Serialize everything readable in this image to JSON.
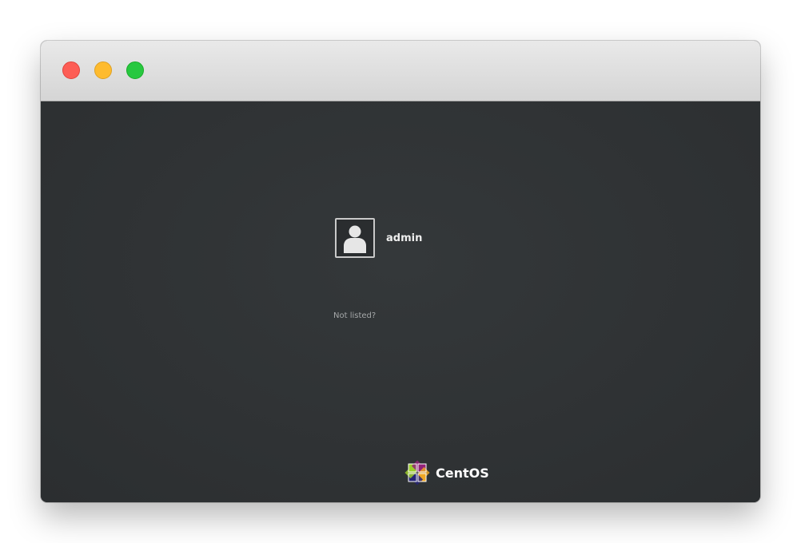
{
  "window": {
    "controls": {
      "close_color": "#fd5d55",
      "minimize_color": "#febb2e",
      "maximize_color": "#27c83f"
    }
  },
  "login": {
    "users": [
      {
        "name": "admin",
        "avatar_icon": "user-avatar-icon"
      }
    ],
    "not_listed_label": "Not listed?"
  },
  "branding": {
    "logo_icon": "centos-logo-icon",
    "name": "CentOS"
  },
  "colors": {
    "background": "#2f3234",
    "text_primary": "#eeeeee",
    "text_secondary": "#a5a8a9"
  }
}
